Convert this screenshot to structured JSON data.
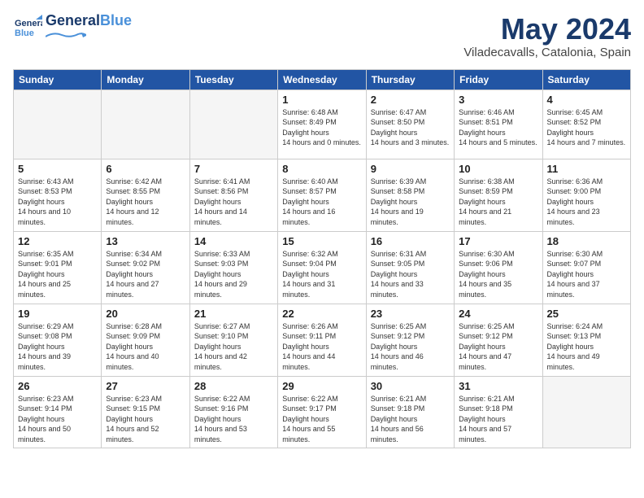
{
  "header": {
    "logo_general": "General",
    "logo_blue": "Blue",
    "month": "May 2024",
    "location": "Viladecavalls, Catalonia, Spain"
  },
  "weekdays": [
    "Sunday",
    "Monday",
    "Tuesday",
    "Wednesday",
    "Thursday",
    "Friday",
    "Saturday"
  ],
  "weeks": [
    [
      {
        "day": "",
        "empty": true
      },
      {
        "day": "",
        "empty": true
      },
      {
        "day": "",
        "empty": true
      },
      {
        "day": "1",
        "sunrise": "6:48 AM",
        "sunset": "8:49 PM",
        "daylight": "14 hours and 0 minutes."
      },
      {
        "day": "2",
        "sunrise": "6:47 AM",
        "sunset": "8:50 PM",
        "daylight": "14 hours and 3 minutes."
      },
      {
        "day": "3",
        "sunrise": "6:46 AM",
        "sunset": "8:51 PM",
        "daylight": "14 hours and 5 minutes."
      },
      {
        "day": "4",
        "sunrise": "6:45 AM",
        "sunset": "8:52 PM",
        "daylight": "14 hours and 7 minutes."
      }
    ],
    [
      {
        "day": "5",
        "sunrise": "6:43 AM",
        "sunset": "8:53 PM",
        "daylight": "14 hours and 10 minutes."
      },
      {
        "day": "6",
        "sunrise": "6:42 AM",
        "sunset": "8:55 PM",
        "daylight": "14 hours and 12 minutes."
      },
      {
        "day": "7",
        "sunrise": "6:41 AM",
        "sunset": "8:56 PM",
        "daylight": "14 hours and 14 minutes."
      },
      {
        "day": "8",
        "sunrise": "6:40 AM",
        "sunset": "8:57 PM",
        "daylight": "14 hours and 16 minutes."
      },
      {
        "day": "9",
        "sunrise": "6:39 AM",
        "sunset": "8:58 PM",
        "daylight": "14 hours and 19 minutes."
      },
      {
        "day": "10",
        "sunrise": "6:38 AM",
        "sunset": "8:59 PM",
        "daylight": "14 hours and 21 minutes."
      },
      {
        "day": "11",
        "sunrise": "6:36 AM",
        "sunset": "9:00 PM",
        "daylight": "14 hours and 23 minutes."
      }
    ],
    [
      {
        "day": "12",
        "sunrise": "6:35 AM",
        "sunset": "9:01 PM",
        "daylight": "14 hours and 25 minutes."
      },
      {
        "day": "13",
        "sunrise": "6:34 AM",
        "sunset": "9:02 PM",
        "daylight": "14 hours and 27 minutes."
      },
      {
        "day": "14",
        "sunrise": "6:33 AM",
        "sunset": "9:03 PM",
        "daylight": "14 hours and 29 minutes."
      },
      {
        "day": "15",
        "sunrise": "6:32 AM",
        "sunset": "9:04 PM",
        "daylight": "14 hours and 31 minutes."
      },
      {
        "day": "16",
        "sunrise": "6:31 AM",
        "sunset": "9:05 PM",
        "daylight": "14 hours and 33 minutes."
      },
      {
        "day": "17",
        "sunrise": "6:30 AM",
        "sunset": "9:06 PM",
        "daylight": "14 hours and 35 minutes."
      },
      {
        "day": "18",
        "sunrise": "6:30 AM",
        "sunset": "9:07 PM",
        "daylight": "14 hours and 37 minutes."
      }
    ],
    [
      {
        "day": "19",
        "sunrise": "6:29 AM",
        "sunset": "9:08 PM",
        "daylight": "14 hours and 39 minutes."
      },
      {
        "day": "20",
        "sunrise": "6:28 AM",
        "sunset": "9:09 PM",
        "daylight": "14 hours and 40 minutes."
      },
      {
        "day": "21",
        "sunrise": "6:27 AM",
        "sunset": "9:10 PM",
        "daylight": "14 hours and 42 minutes."
      },
      {
        "day": "22",
        "sunrise": "6:26 AM",
        "sunset": "9:11 PM",
        "daylight": "14 hours and 44 minutes."
      },
      {
        "day": "23",
        "sunrise": "6:25 AM",
        "sunset": "9:12 PM",
        "daylight": "14 hours and 46 minutes."
      },
      {
        "day": "24",
        "sunrise": "6:25 AM",
        "sunset": "9:12 PM",
        "daylight": "14 hours and 47 minutes."
      },
      {
        "day": "25",
        "sunrise": "6:24 AM",
        "sunset": "9:13 PM",
        "daylight": "14 hours and 49 minutes."
      }
    ],
    [
      {
        "day": "26",
        "sunrise": "6:23 AM",
        "sunset": "9:14 PM",
        "daylight": "14 hours and 50 minutes."
      },
      {
        "day": "27",
        "sunrise": "6:23 AM",
        "sunset": "9:15 PM",
        "daylight": "14 hours and 52 minutes."
      },
      {
        "day": "28",
        "sunrise": "6:22 AM",
        "sunset": "9:16 PM",
        "daylight": "14 hours and 53 minutes."
      },
      {
        "day": "29",
        "sunrise": "6:22 AM",
        "sunset": "9:17 PM",
        "daylight": "14 hours and 55 minutes."
      },
      {
        "day": "30",
        "sunrise": "6:21 AM",
        "sunset": "9:18 PM",
        "daylight": "14 hours and 56 minutes."
      },
      {
        "day": "31",
        "sunrise": "6:21 AM",
        "sunset": "9:18 PM",
        "daylight": "14 hours and 57 minutes."
      },
      {
        "day": "",
        "empty": true
      }
    ]
  ],
  "labels": {
    "sunrise": "Sunrise:",
    "sunset": "Sunset:",
    "daylight": "Daylight hours"
  }
}
